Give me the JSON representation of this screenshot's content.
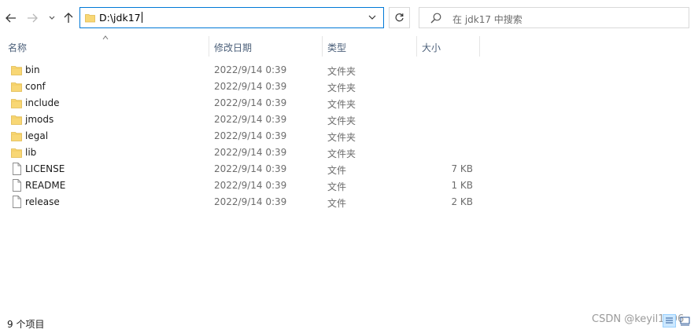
{
  "address": {
    "path": "D:\\jdk17"
  },
  "search": {
    "placeholder": "在 jdk17 中搜索"
  },
  "columns": {
    "name": "名称",
    "date": "修改日期",
    "type": "类型",
    "size": "大小"
  },
  "files": [
    {
      "name": "bin",
      "date": "2022/9/14 0:39",
      "type": "文件夹",
      "size": "",
      "kind": "folder"
    },
    {
      "name": "conf",
      "date": "2022/9/14 0:39",
      "type": "文件夹",
      "size": "",
      "kind": "folder"
    },
    {
      "name": "include",
      "date": "2022/9/14 0:39",
      "type": "文件夹",
      "size": "",
      "kind": "folder"
    },
    {
      "name": "jmods",
      "date": "2022/9/14 0:39",
      "type": "文件夹",
      "size": "",
      "kind": "folder"
    },
    {
      "name": "legal",
      "date": "2022/9/14 0:39",
      "type": "文件夹",
      "size": "",
      "kind": "folder"
    },
    {
      "name": "lib",
      "date": "2022/9/14 0:39",
      "type": "文件夹",
      "size": "",
      "kind": "folder"
    },
    {
      "name": "LICENSE",
      "date": "2022/9/14 0:39",
      "type": "文件",
      "size": "7 KB",
      "kind": "file"
    },
    {
      "name": "README",
      "date": "2022/9/14 0:39",
      "type": "文件",
      "size": "1 KB",
      "kind": "file"
    },
    {
      "name": "release",
      "date": "2022/9/14 0:39",
      "type": "文件",
      "size": "2 KB",
      "kind": "file"
    }
  ],
  "status": {
    "item_count": "9 个项目"
  },
  "watermark": "CSDN @keyil1796",
  "colors": {
    "accent": "#0078d7",
    "folder": "#f8d775",
    "header_text": "#4c607a",
    "selected_view": "#cce8ff"
  }
}
